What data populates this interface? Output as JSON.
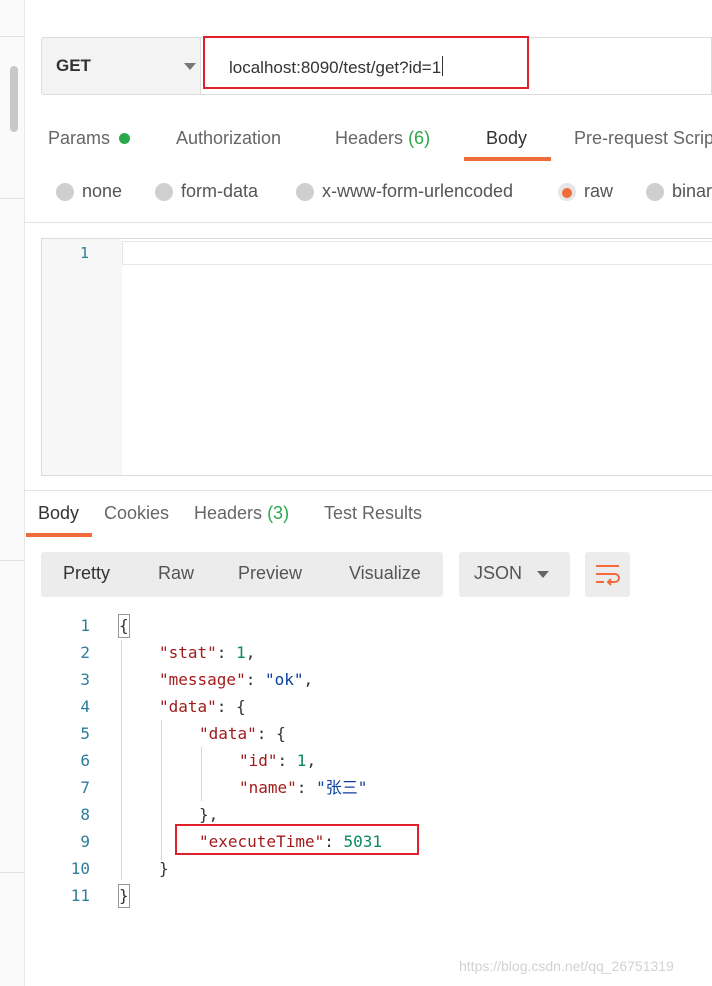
{
  "request": {
    "method": "GET",
    "url": "localhost:8090/test/get?id=1"
  },
  "request_tabs": {
    "params": "Params",
    "authorization": "Authorization",
    "headers": "Headers",
    "headers_count": "(6)",
    "body": "Body",
    "prerequest": "Pre-request Scrip"
  },
  "body_types": {
    "none": "none",
    "form_data": "form-data",
    "urlencoded": "x-www-form-urlencoded",
    "raw": "raw",
    "binary": "binar",
    "selected": "raw"
  },
  "request_editor": {
    "line_number": "1"
  },
  "response_tabs": {
    "body": "Body",
    "cookies": "Cookies",
    "headers": "Headers",
    "headers_count": "(3)",
    "test_results": "Test Results"
  },
  "view_modes": {
    "pretty": "Pretty",
    "raw": "Raw",
    "preview": "Preview",
    "visualize": "Visualize",
    "format": "JSON"
  },
  "response_code": {
    "line_numbers": [
      "1",
      "2",
      "3",
      "4",
      "5",
      "6",
      "7",
      "8",
      "9",
      "10",
      "11"
    ],
    "open_brace": "{",
    "stat_key": "\"stat\"",
    "stat_value": "1",
    "message_key": "\"message\"",
    "message_value": "\"ok\"",
    "data_key": "\"data\"",
    "inner_data_key": "\"data\"",
    "id_key": "\"id\"",
    "id_value": "1",
    "name_key": "\"name\"",
    "name_value": "\"张三\"",
    "execute_key": "\"executeTime\"",
    "execute_value": "5031",
    "close_brace": "}"
  },
  "watermark": "https://blog.csdn.net/qq_26751319",
  "colors": {
    "accent": "#f26b3a",
    "highlight_box": "#e0202a",
    "badge_green": "#2aa84a"
  }
}
